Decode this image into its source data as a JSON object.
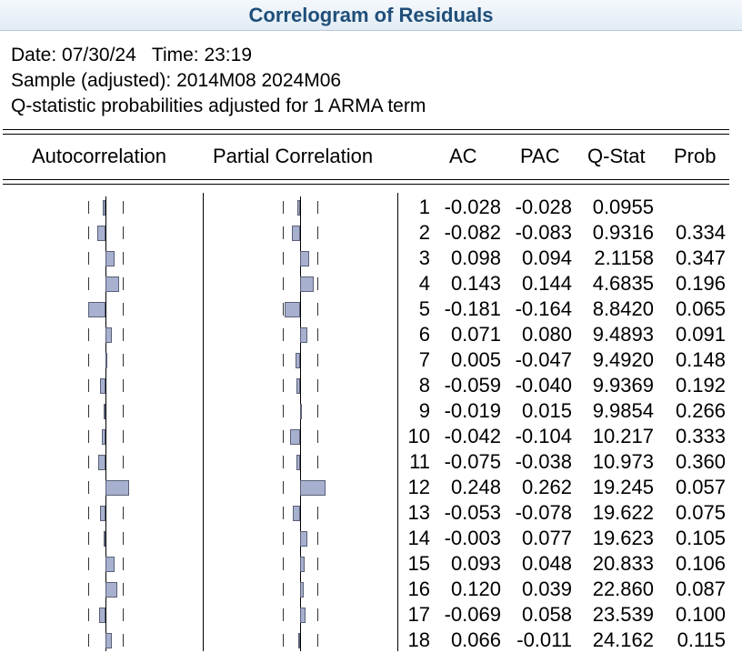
{
  "title": "Correlogram of Residuals",
  "info": {
    "date_line": "Date: 07/30/24   Time: 23:19",
    "sample_line": "Sample (adjusted): 2014M08 2024M06",
    "note_line": "Q-statistic probabilities adjusted for 1 ARMA term"
  },
  "headers": {
    "autocorrelation": "Autocorrelation",
    "partial_correlation": "Partial Correlation",
    "ac": "AC",
    "pac": "PAC",
    "qstat": "Q-Stat",
    "prob": "Prob"
  },
  "chart_data": {
    "type": "table",
    "lags": [
      1,
      2,
      3,
      4,
      5,
      6,
      7,
      8,
      9,
      10,
      11,
      12,
      13,
      14,
      15,
      16,
      17,
      18
    ],
    "ac": [
      "-0.028",
      "-0.082",
      "0.098",
      "0.143",
      "-0.181",
      "0.071",
      "0.005",
      "-0.059",
      "-0.019",
      "-0.042",
      "-0.075",
      "0.248",
      "-0.053",
      "-0.003",
      "0.093",
      "0.120",
      "-0.069",
      "0.066"
    ],
    "pac": [
      "-0.028",
      "-0.083",
      "0.094",
      "0.144",
      "-0.164",
      "0.080",
      "-0.047",
      "-0.040",
      "0.015",
      "-0.104",
      "-0.038",
      "0.262",
      "-0.078",
      "0.077",
      "0.048",
      "0.039",
      "0.058",
      "-0.011"
    ],
    "qstat": [
      "0.0955",
      "0.9316",
      "2.1158",
      "4.6835",
      "8.8420",
      "9.4893",
      "9.4920",
      "9.9369",
      "9.9854",
      "10.217",
      "10.973",
      "19.245",
      "19.622",
      "19.623",
      "20.833",
      "22.860",
      "23.539",
      "24.162"
    ],
    "prob": [
      "",
      "0.334",
      "0.347",
      "0.196",
      "0.065",
      "0.091",
      "0.148",
      "0.192",
      "0.266",
      "0.333",
      "0.360",
      "0.057",
      "0.075",
      "0.105",
      "0.106",
      "0.087",
      "0.100",
      "0.115"
    ],
    "confidence_bound": 0.18,
    "bar_color": "#a8b0cf"
  }
}
